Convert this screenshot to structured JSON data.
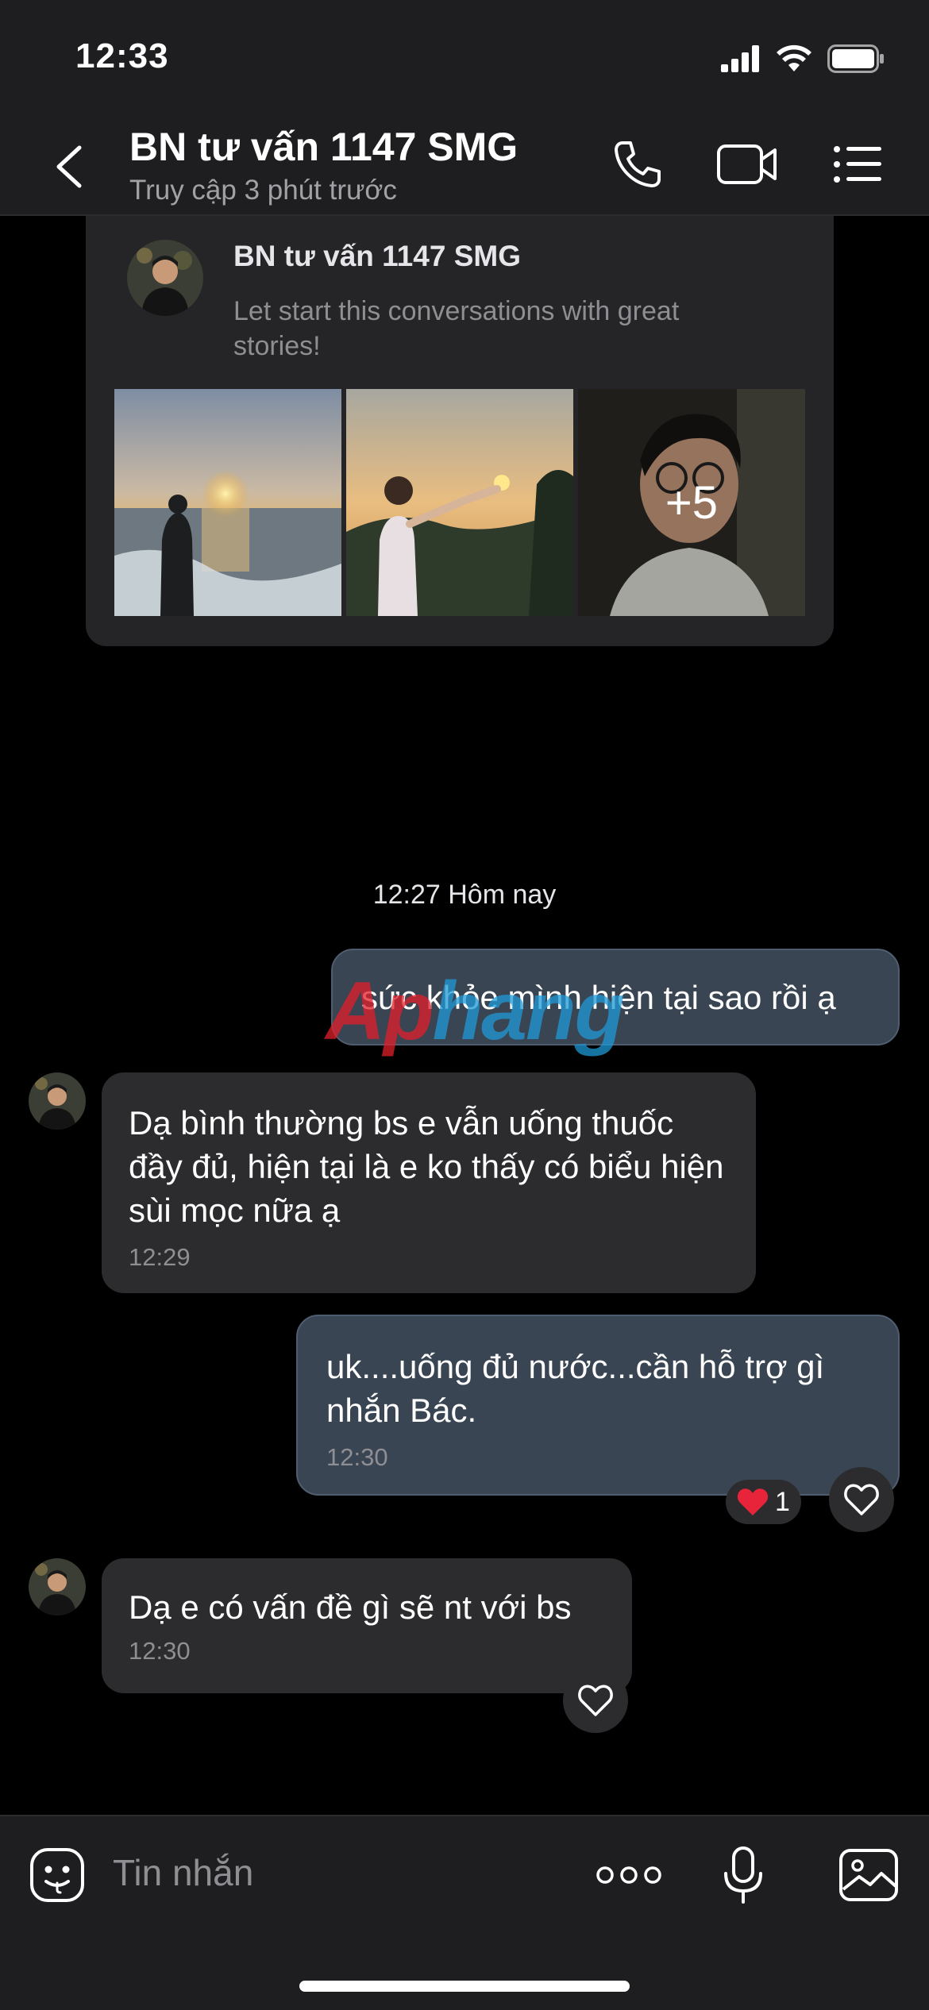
{
  "status_bar": {
    "time": "12:33"
  },
  "header": {
    "title": "BN tư vấn 1147 SMG",
    "subtitle": "Truy cập 3 phút trước"
  },
  "story": {
    "name": "BN tư vấn 1147 SMG",
    "description": "Let start this conversations with great stories!",
    "more_count": "+5"
  },
  "date_separator": "12:27 Hôm nay",
  "messages": [
    {
      "direction": "out",
      "text": "sức khỏe mình hiện tại sao rồi ạ"
    },
    {
      "direction": "in",
      "text": "Dạ bình thường bs e vẫn uống thuốc đầy đủ, hiện tại là e ko thấy có biểu hiện sùi mọc nữa ạ",
      "time": "12:29"
    },
    {
      "direction": "out",
      "text": "uk....uống đủ nước...cần hỗ trợ gì nhắn Bác.",
      "time": "12:30",
      "reaction_count": "1"
    },
    {
      "direction": "in",
      "text": "Dạ e có vấn đề gì sẽ nt với bs",
      "time": "12:30"
    }
  ],
  "watermark": {
    "part1": "Ap",
    "part2": "hang"
  },
  "input": {
    "placeholder": "Tin nhắn"
  },
  "icons": {
    "back": "chevron-left-icon",
    "call": "phone-icon",
    "video": "video-camera-icon",
    "menu": "list-icon",
    "emoji": "sticker-icon",
    "more": "more-dots-icon",
    "mic": "microphone-icon",
    "image": "image-icon",
    "heart": "heart-icon"
  },
  "colors": {
    "background": "#000000",
    "bar": "#1e1e20",
    "outgoing_bubble": "#3a4553",
    "incoming_bubble": "#2c2c2e",
    "heart": "#e8243b"
  }
}
